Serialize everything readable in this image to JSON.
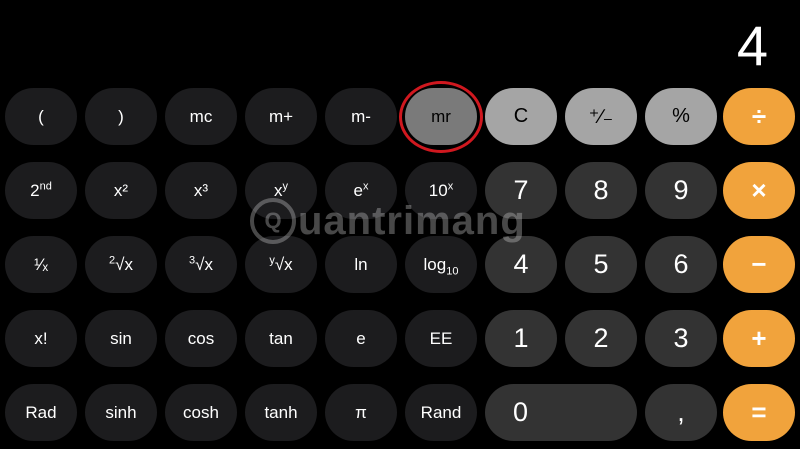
{
  "display": {
    "value": "4"
  },
  "colors": {
    "background": "#000000",
    "scientific_key": "#1c1c1e",
    "digit_key": "#333333",
    "function_key": "#a5a5a5",
    "operator_key": "#f1a33c",
    "highlight_ring": "#d0181f"
  },
  "keys": {
    "open_paren": "(",
    "close_paren": ")",
    "mc": "mc",
    "m_plus": "m+",
    "m_minus": "m-",
    "mr": "mr",
    "clear": "C",
    "plus_minus": "⁺∕₋",
    "percent": "%",
    "divide": "÷",
    "second_base": "2",
    "second_sup": "nd",
    "x_squared": "x²",
    "x_cubed": "x³",
    "x_pow_base": "x",
    "x_pow_sup": "y",
    "e_pow_base": "e",
    "e_pow_sup": "x",
    "ten_pow_base": "10",
    "ten_pow_sup": "x",
    "seven": "7",
    "eight": "8",
    "nine": "9",
    "multiply": "×",
    "reciprocal": "¹⁄ₓ",
    "sqrt2_idx": "2",
    "sqrt2_rad": "√x",
    "sqrt3_idx": "3",
    "sqrt3_rad": "√x",
    "sqrty_idx": "y",
    "sqrty_rad": "√x",
    "ln": "ln",
    "log_base": "log",
    "log_sub": "10",
    "four": "4",
    "five": "5",
    "six": "6",
    "minus": "−",
    "factorial": "x!",
    "sin": "sin",
    "cos": "cos",
    "tan": "tan",
    "e": "e",
    "ee": "EE",
    "one": "1",
    "two": "2",
    "three": "3",
    "plus": "+",
    "rad": "Rad",
    "sinh": "sinh",
    "cosh": "cosh",
    "tanh": "tanh",
    "pi": "π",
    "rand": "Rand",
    "zero": "0",
    "decimal": ",",
    "equals": "="
  },
  "watermark": {
    "logo_letter": "Q",
    "text": "uantrimang"
  }
}
